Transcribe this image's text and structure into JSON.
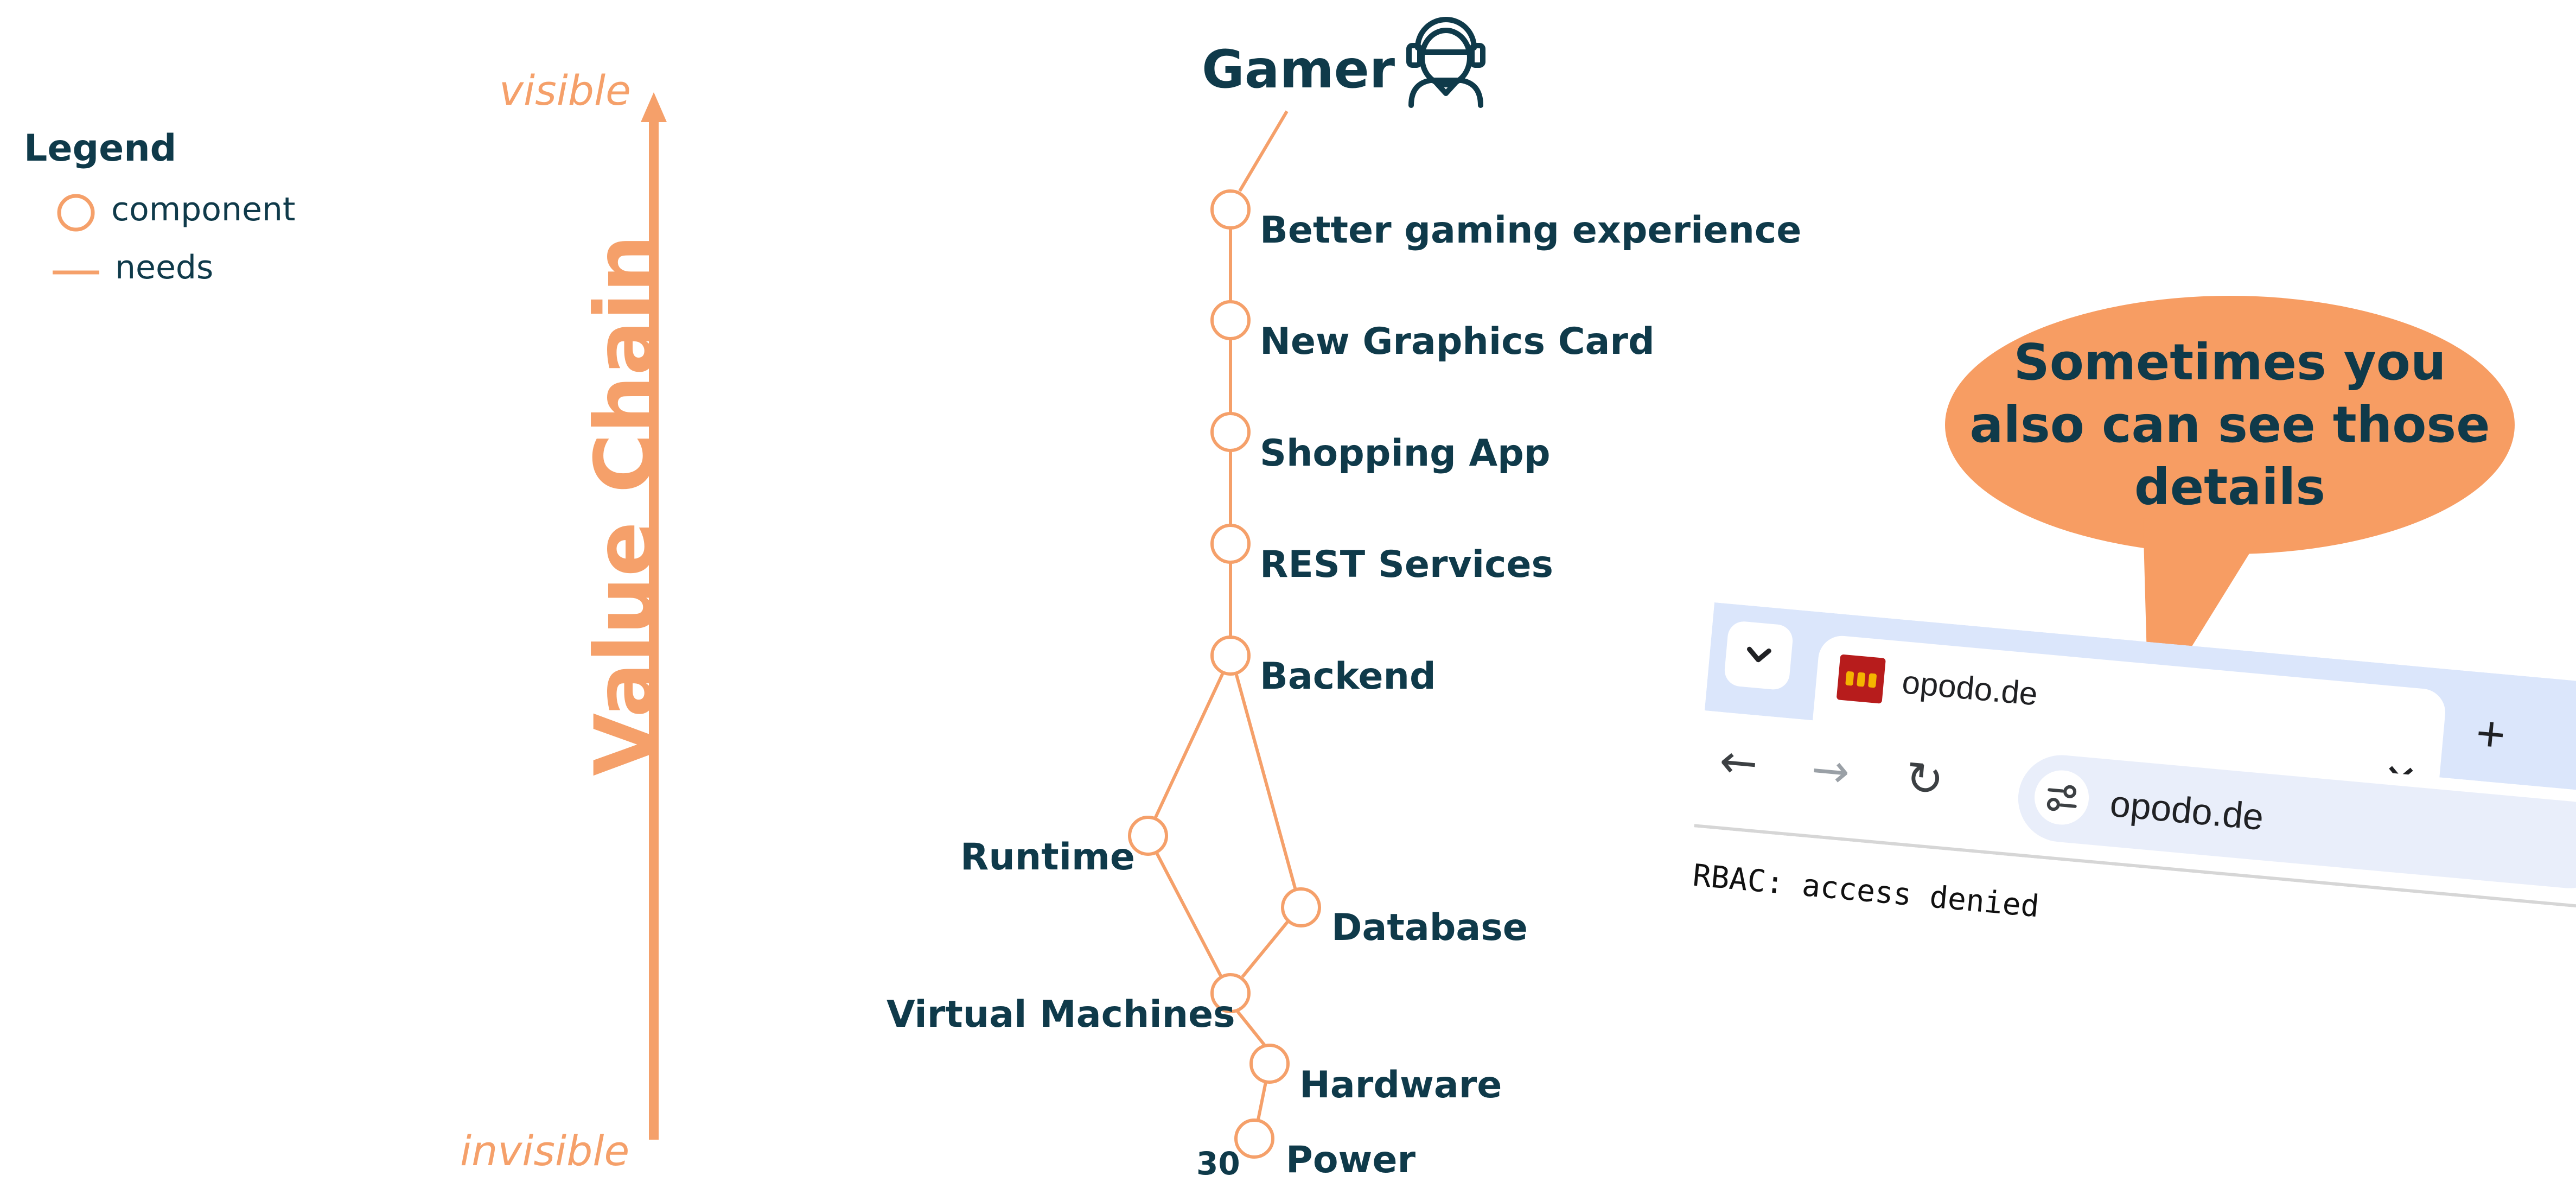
{
  "legend": {
    "title": "Legend",
    "component_label": "component",
    "needs_label": "needs"
  },
  "axis": {
    "top_label": "visible",
    "bottom_label": "invisible",
    "title": "Value Chain"
  },
  "user": {
    "label": "Gamer",
    "icon": "gamer-headset-icon"
  },
  "nodes": {
    "better_gaming": "Better gaming experience",
    "graphics_card": "New Graphics Card",
    "shopping_app": "Shopping App",
    "rest_services": "REST Services",
    "backend": "Backend",
    "runtime": "Runtime",
    "database": "Database",
    "virtual_machines": "Virtual Machines",
    "hardware": "Hardware",
    "power": "Power"
  },
  "edges": [
    [
      "gamer",
      "better_gaming"
    ],
    [
      "better_gaming",
      "graphics_card"
    ],
    [
      "graphics_card",
      "shopping_app"
    ],
    [
      "shopping_app",
      "rest_services"
    ],
    [
      "rest_services",
      "backend"
    ],
    [
      "backend",
      "runtime"
    ],
    [
      "backend",
      "database"
    ],
    [
      "runtime",
      "virtual_machines"
    ],
    [
      "database",
      "virtual_machines"
    ],
    [
      "virtual_machines",
      "hardware"
    ],
    [
      "hardware",
      "power"
    ]
  ],
  "callout": {
    "text": "Sometimes you also can see those details"
  },
  "browser": {
    "tab_title": "opodo.de",
    "url": "opodo.de",
    "page_text": "RBAC: access denied",
    "tab_list_icon": "chevron-down-icon",
    "close_icon": "close-icon",
    "new_tab_icon": "plus-icon",
    "back_icon": "back-arrow-icon",
    "forward_icon": "forward-arrow-icon",
    "reload_icon": "reload-icon",
    "site_settings_icon": "tune-icon"
  },
  "slide_number": "30",
  "colors": {
    "navy": "#0f3a4a",
    "orange": "#f5a06a",
    "callout": "#f79d63",
    "browser_chrome": "#dbe6fb"
  }
}
